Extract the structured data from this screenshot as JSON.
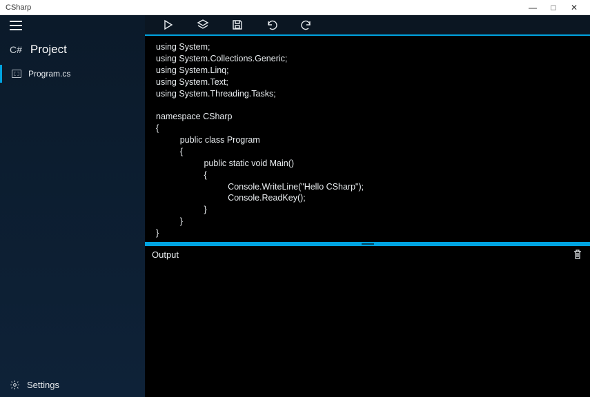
{
  "window": {
    "title": "CSharp",
    "controls": {
      "min": "—",
      "max": "□",
      "close": "✕"
    }
  },
  "sidebar": {
    "language_tag": "C#",
    "project_label": "Project",
    "files": [
      {
        "name": "Program.cs"
      }
    ],
    "settings_label": "Settings"
  },
  "toolbar": {
    "run": "run-icon",
    "layers": "layers-icon",
    "save": "save-icon",
    "undo": "undo-icon",
    "redo": "redo-icon"
  },
  "editor": {
    "code": "using System;\nusing System.Collections.Generic;\nusing System.Linq;\nusing System.Text;\nusing System.Threading.Tasks;\n\nnamespace CSharp\n{\n          public class Program\n          {\n                    public static void Main()\n                    {\n                              Console.WriteLine(\"Hello CSharp\");\n                              Console.ReadKey();\n                    }\n          }\n}"
  },
  "output": {
    "header": "Output"
  }
}
